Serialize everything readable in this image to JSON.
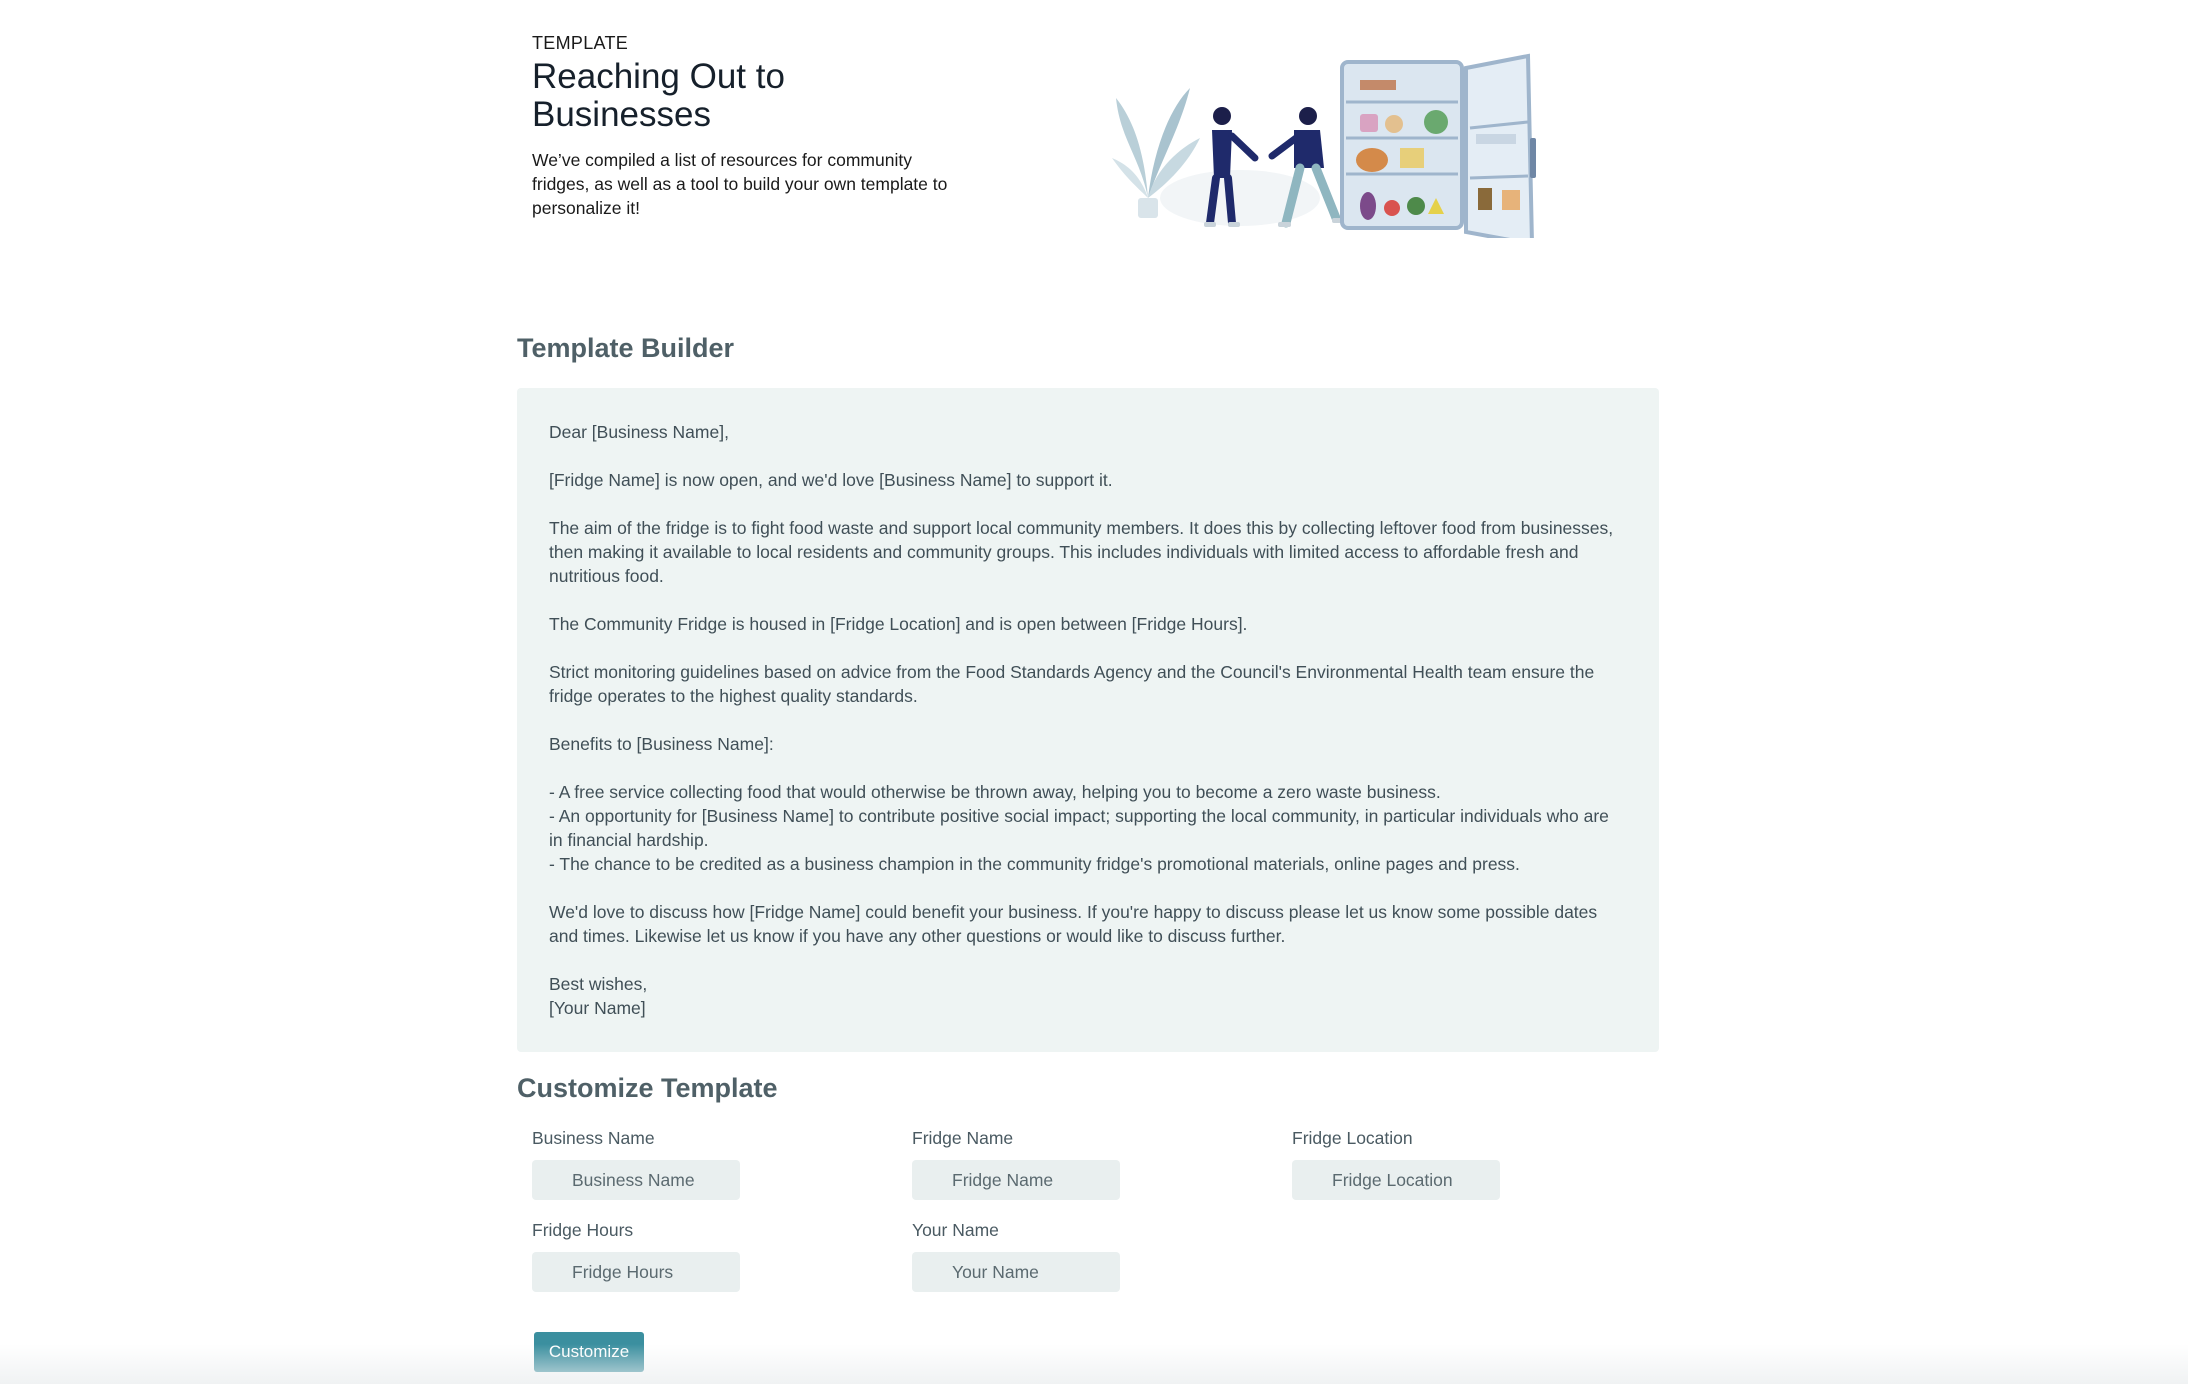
{
  "hero": {
    "eyebrow": "TEMPLATE",
    "title": "Reaching Out to Businesses",
    "description": "We’ve compiled a list of resources for community fridges, as well as a tool to build your own template to personalize it!"
  },
  "template_builder": {
    "title": "Template Builder",
    "paragraphs": [
      "Dear [Business Name],",
      "[Fridge Name] is now open, and we'd love [Business Name] to support it.",
      "The aim of the fridge is to fight food waste and support local community members. It does this by collecting leftover food from businesses, then making it available to local residents and community groups. This includes individuals with limited access to affordable fresh and nutritious food.",
      "The Community Fridge is housed in [Fridge Location] and is open between [Fridge Hours].",
      "Strict monitoring guidelines based on advice from the Food Standards Agency and the Council's Environmental Health team ensure the fridge operates to the highest quality standards.",
      "Benefits to [Business Name]:",
      "- A free service collecting food that would otherwise be thrown away, helping you to become a zero waste business.\n- An opportunity for [Business Name] to contribute positive social impact; supporting the local community, in particular individuals who are in financial hardship.\n- The chance to be credited as a business champion in the community fridge's promotional materials, online pages and press.",
      "We'd love to discuss how [Fridge Name] could benefit your business. If you're happy to discuss please let us know some possible dates and times. Likewise let us know if you have any other questions or would like to discuss further.",
      "Best wishes,\n[Your Name]"
    ]
  },
  "customize": {
    "title": "Customize Template",
    "fields": [
      {
        "label": "Business Name",
        "placeholder": "Business Name"
      },
      {
        "label": "Fridge Name",
        "placeholder": "Fridge Name"
      },
      {
        "label": "Fridge Location",
        "placeholder": "Fridge Location"
      },
      {
        "label": "Fridge Hours",
        "placeholder": "Fridge Hours"
      },
      {
        "label": "Your Name",
        "placeholder": "Your Name"
      }
    ],
    "button_label": "Customize"
  },
  "colors": {
    "accent": "#3b8f9f",
    "letter_background": "#eef4f3",
    "heading": "#4f6067"
  },
  "illustration": {
    "icon": "two-people-at-community-fridge-illustration"
  }
}
